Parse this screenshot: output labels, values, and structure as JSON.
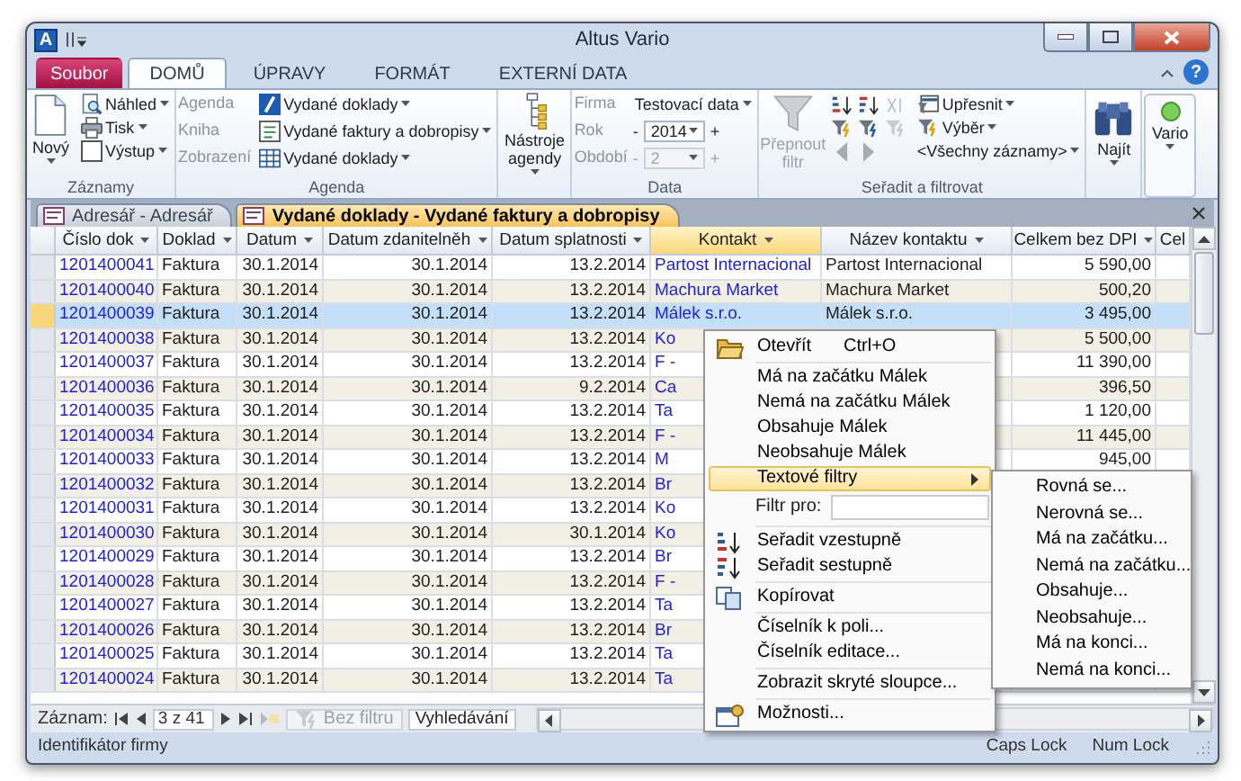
{
  "window": {
    "app_icon": "A",
    "title": "Altus Vario",
    "help": "?"
  },
  "ribbon_tabs": [
    {
      "label": "Soubor",
      "kind": "file",
      "selected": false
    },
    {
      "label": "DOMŮ",
      "kind": "tab",
      "selected": true
    },
    {
      "label": "ÚPRAVY",
      "kind": "tab",
      "selected": false
    },
    {
      "label": "FORMÁT",
      "kind": "tab",
      "selected": false
    },
    {
      "label": "EXTERNÍ DATA",
      "kind": "tab",
      "selected": false
    }
  ],
  "ribbon": {
    "records": {
      "label": "Záznamy",
      "new": "Nový",
      "commands": [
        "Náhled",
        "Tisk",
        "Výstup"
      ]
    },
    "agenda": {
      "label": "Agenda",
      "rows": [
        {
          "label": "Agenda",
          "value": "Vydané doklady"
        },
        {
          "label": "Kniha",
          "value": "Vydané faktury a dobropisy"
        },
        {
          "label": "Zobrazení",
          "value": "Vydané doklady"
        }
      ]
    },
    "tools": {
      "label": "Nástroje agendy"
    },
    "data": {
      "label": "Data",
      "rows": [
        {
          "label": "Firma",
          "kind": "dropdown",
          "value": "Testovací data",
          "disabled": false
        },
        {
          "label": "Rok",
          "kind": "spinner",
          "value": "2014",
          "minus": "-",
          "plus": "+",
          "disabled": false
        },
        {
          "label": "Období",
          "kind": "spinner",
          "value": "2",
          "minus": "-",
          "plus": "+",
          "disabled": true
        }
      ]
    },
    "sort_filter": {
      "label": "Seřadit a filtrovat",
      "toggle": {
        "label": "Přepnout filtr",
        "disabled": true
      },
      "commands": [
        {
          "label": "Upřesnit"
        },
        {
          "label": "Výběr"
        },
        {
          "label": "<Všechny záznamy>"
        }
      ]
    },
    "find": {
      "label": "Najít"
    },
    "vario": {
      "label": "Vario"
    }
  },
  "document_tabs": [
    {
      "label": "Adresář - Adresář",
      "selected": false
    },
    {
      "label": "Vydané doklady - Vydané faktury a dobropisy",
      "selected": true
    }
  ],
  "table": {
    "columns": [
      {
        "label": "Číslo dok",
        "dropdown": true,
        "selected": false
      },
      {
        "label": "Doklad",
        "dropdown": true,
        "selected": false
      },
      {
        "label": "Datum",
        "dropdown": true,
        "selected": false
      },
      {
        "label": "Datum zdanitelněh",
        "dropdown": true,
        "selected": false
      },
      {
        "label": "Datum splatnosti",
        "dropdown": true,
        "selected": false
      },
      {
        "label": "Kontakt",
        "dropdown": true,
        "selected": true
      },
      {
        "label": "Název kontaktu",
        "dropdown": true,
        "selected": false
      },
      {
        "label": "Celkem bez DPI",
        "dropdown": true,
        "selected": false
      },
      {
        "label": "Cel",
        "dropdown": false,
        "selected": false
      }
    ],
    "rows": [
      {
        "selected": false,
        "cells": [
          "1201400041",
          "Faktura",
          "30.1.2014",
          "30.1.2014",
          "13.2.2014",
          "Partost Internacional",
          "Partost Internacional",
          "5 590,00"
        ]
      },
      {
        "selected": false,
        "cells": [
          "1201400040",
          "Faktura",
          "30.1.2014",
          "30.1.2014",
          "13.2.2014",
          "Machura Market",
          "Machura Market",
          "500,20"
        ]
      },
      {
        "selected": true,
        "cells": [
          "1201400039",
          "Faktura",
          "30.1.2014",
          "30.1.2014",
          "13.2.2014",
          "Málek s.r.o.",
          "Málek s.r.o.",
          "3 495,00"
        ]
      },
      {
        "selected": false,
        "cells": [
          "1201400038",
          "Faktura",
          "30.1.2014",
          "30.1.2014",
          "13.2.2014",
          "Ko",
          null,
          "5 500,00"
        ]
      },
      {
        "selected": false,
        "cells": [
          "1201400037",
          "Faktura",
          "30.1.2014",
          "30.1.2014",
          "13.2.2014",
          "F -",
          null,
          "11 390,00"
        ]
      },
      {
        "selected": false,
        "cells": [
          "1201400036",
          "Faktura",
          "30.1.2014",
          "30.1.2014",
          "9.2.2014",
          "Ca",
          null,
          "396,50"
        ]
      },
      {
        "selected": false,
        "cells": [
          "1201400035",
          "Faktura",
          "30.1.2014",
          "30.1.2014",
          "13.2.2014",
          "Ta",
          null,
          "1 120,00"
        ]
      },
      {
        "selected": false,
        "cells": [
          "1201400034",
          "Faktura",
          "30.1.2014",
          "30.1.2014",
          "13.2.2014",
          "F -",
          null,
          "11 445,00"
        ]
      },
      {
        "selected": false,
        "cells": [
          "1201400033",
          "Faktura",
          "30.1.2014",
          "30.1.2014",
          "13.2.2014",
          "M",
          null,
          "945,00"
        ]
      },
      {
        "selected": false,
        "cells": [
          "1201400032",
          "Faktura",
          "30.1.2014",
          "30.1.2014",
          "13.2.2014",
          "Br",
          null,
          null
        ]
      },
      {
        "selected": false,
        "cells": [
          "1201400031",
          "Faktura",
          "30.1.2014",
          "30.1.2014",
          "13.2.2014",
          "Ko",
          null,
          null
        ]
      },
      {
        "selected": false,
        "cells": [
          "1201400030",
          "Faktura",
          "30.1.2014",
          "30.1.2014",
          "30.1.2014",
          "Ko",
          null,
          null
        ]
      },
      {
        "selected": false,
        "cells": [
          "1201400029",
          "Faktura",
          "30.1.2014",
          "30.1.2014",
          "13.2.2014",
          "Br",
          null,
          null
        ]
      },
      {
        "selected": false,
        "cells": [
          "1201400028",
          "Faktura",
          "30.1.2014",
          "30.1.2014",
          "13.2.2014",
          "F -",
          null,
          null
        ]
      },
      {
        "selected": false,
        "cells": [
          "1201400027",
          "Faktura",
          "30.1.2014",
          "30.1.2014",
          "13.2.2014",
          "Ta",
          null,
          null
        ]
      },
      {
        "selected": false,
        "cells": [
          "1201400026",
          "Faktura",
          "30.1.2014",
          "30.1.2014",
          "13.2.2014",
          "Br",
          null,
          null
        ]
      },
      {
        "selected": false,
        "cells": [
          "1201400025",
          "Faktura",
          "30.1.2014",
          "30.1.2014",
          "13.2.2014",
          "Ta",
          null,
          null
        ]
      },
      {
        "selected": false,
        "cells": [
          "1201400024",
          "Faktura",
          "30.1.2014",
          "30.1.2014",
          "13.2.2014",
          "Ta",
          null,
          null
        ]
      }
    ]
  },
  "navigation": {
    "label": "Záznam:",
    "position": "3 z 41",
    "filter": {
      "label": "Bez filtru",
      "disabled": true
    },
    "search": {
      "placeholder": "Vyhledávání"
    }
  },
  "status_bar": {
    "text": "Identifikátor firmy",
    "indicators": [
      "Caps Lock",
      "Num Lock"
    ]
  },
  "context_menu": {
    "items": [
      {
        "kind": "command",
        "label": "Otevřít",
        "shortcut": "Ctrl+O",
        "selected": false
      },
      {
        "kind": "separator"
      },
      {
        "kind": "command",
        "label": "Má na začátku Málek",
        "selected": false
      },
      {
        "kind": "command",
        "label": "Nemá na začátku Málek",
        "selected": false
      },
      {
        "kind": "command",
        "label": "Obsahuje Málek",
        "selected": false
      },
      {
        "kind": "command",
        "label": "Neobsahuje Málek",
        "selected": false
      },
      {
        "kind": "submenu",
        "label": "Textové filtry",
        "selected": true,
        "items": [
          "Rovná se...",
          "Nerovná se...",
          "Má na začátku...",
          "Nemá na začátku...",
          "Obsahuje...",
          "Neobsahuje...",
          "Má na konci...",
          "Nemá na konci..."
        ]
      },
      {
        "kind": "filter",
        "label": "Filtr pro:"
      },
      {
        "kind": "separator"
      },
      {
        "kind": "command",
        "label": "Seřadit vzestupně",
        "selected": false
      },
      {
        "kind": "command",
        "label": "Seřadit sestupně",
        "selected": false
      },
      {
        "kind": "separator"
      },
      {
        "kind": "command",
        "label": "Kopírovat",
        "selected": false
      },
      {
        "kind": "separator"
      },
      {
        "kind": "command",
        "label": "Číselník k poli...",
        "selected": false
      },
      {
        "kind": "command",
        "label": "Číselník editace...",
        "selected": false
      },
      {
        "kind": "separator"
      },
      {
        "kind": "command",
        "label": "Zobrazit skryté sloupce...",
        "selected": false
      },
      {
        "kind": "separator"
      },
      {
        "kind": "command",
        "label": "Možnosti...",
        "selected": false
      }
    ]
  }
}
